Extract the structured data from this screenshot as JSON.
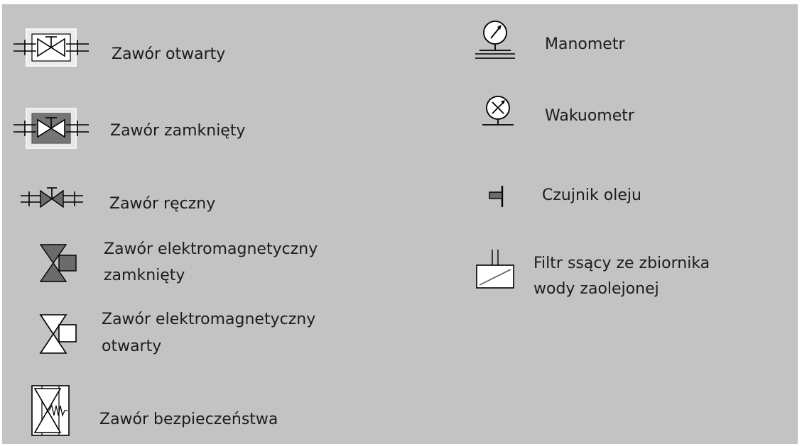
{
  "colors": {
    "background": "#c3c3c3",
    "line": "#000000",
    "fill_dark": "#6b6b6b",
    "fill_white": "#ffffff",
    "frame_light": "#f4f4f4"
  },
  "legend": {
    "left": [
      {
        "icon": "open-valve-icon",
        "label": "Zawór otwarty"
      },
      {
        "icon": "closed-valve-icon",
        "label": "Zawór zamknięty"
      },
      {
        "icon": "manual-valve-icon",
        "label": "Zawór ręczny"
      },
      {
        "icon": "solenoid-valve-closed-icon",
        "label_line1": "Zawór elektromagnetyczny",
        "label_line2": "zamknięty"
      },
      {
        "icon": "solenoid-valve-open-icon",
        "label_line1": "Zawór elektromagnetyczny",
        "label_line2": "otwarty"
      },
      {
        "icon": "safety-valve-icon",
        "label": "Zawór bezpieczeństwa"
      }
    ],
    "right": [
      {
        "icon": "pressure-gauge-icon",
        "label": "Manometr"
      },
      {
        "icon": "vacuum-gauge-icon",
        "label": "Wakuometr"
      },
      {
        "icon": "oil-sensor-icon",
        "label": "Czujnik oleju"
      },
      {
        "icon": "suction-filter-icon",
        "label_line1": "Filtr ssący ze zbiornika",
        "label_line2": "wody zaolejonej"
      }
    ]
  }
}
